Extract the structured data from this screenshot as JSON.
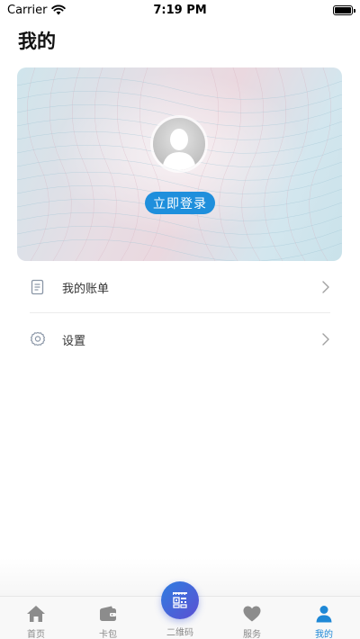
{
  "status_bar": {
    "carrier": "Carrier",
    "time": "7:19 PM"
  },
  "page": {
    "title": "我的"
  },
  "login_card": {
    "login_label": "立即登录"
  },
  "menu": {
    "items": [
      {
        "label": "我的账单",
        "icon": "bill-icon"
      },
      {
        "label": "设置",
        "icon": "settings-gear-icon"
      }
    ]
  },
  "tab_bar": {
    "tabs": [
      {
        "label": "首页",
        "icon": "home-icon"
      },
      {
        "label": "卡包",
        "icon": "wallet-icon"
      },
      {
        "label": "二维码",
        "icon": "qr-code-icon"
      },
      {
        "label": "服务",
        "icon": "heart-icon"
      },
      {
        "label": "我的",
        "icon": "person-icon"
      }
    ],
    "active_index": 4
  },
  "colors": {
    "accent": "#1f8fdc",
    "active_tab": "#1e88d6"
  }
}
